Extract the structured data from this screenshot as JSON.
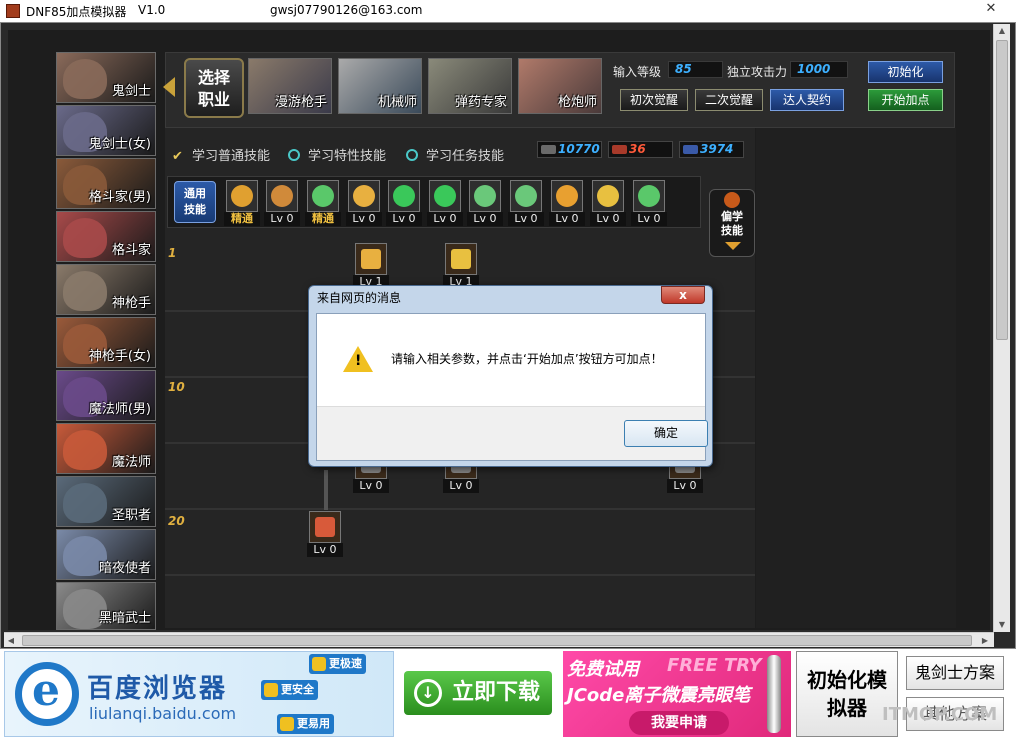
{
  "window": {
    "title": "DNF85加点模拟器",
    "version": "V1.0",
    "email": "gwsj07790126@163.com",
    "close_glyph": "✕"
  },
  "classes": [
    {
      "label": "鬼剑士",
      "color": "#8a6a5a"
    },
    {
      "label": "鬼剑士(女)",
      "color": "#6a6a8a"
    },
    {
      "label": "格斗家(男)",
      "color": "#8a5a3a"
    },
    {
      "label": "格斗家",
      "color": "#a84a4a"
    },
    {
      "label": "神枪手",
      "color": "#8a7a6a"
    },
    {
      "label": "神枪手(女)",
      "color": "#9a5a3a"
    },
    {
      "label": "魔法师(男)",
      "color": "#6a4a8a"
    },
    {
      "label": "魔法师",
      "color": "#c85a3a"
    },
    {
      "label": "圣职者",
      "color": "#5a6a7a"
    },
    {
      "label": "暗夜使者",
      "color": "#7a8aa8"
    },
    {
      "label": "黑暗武士",
      "color": "#8a8a8a"
    }
  ],
  "select_class": {
    "line1": "选择",
    "line2": "职业"
  },
  "subclasses": [
    {
      "label": "漫游枪手"
    },
    {
      "label": "机械师"
    },
    {
      "label": "弹药专家"
    },
    {
      "label": "枪炮师"
    }
  ],
  "inputs": {
    "level_label": "输入等级",
    "level_value": "85",
    "attack_label": "独立攻击力",
    "attack_value": "1000"
  },
  "awaken": {
    "first": "初次觉醒",
    "second": "二次觉醒",
    "contract": "达人契约"
  },
  "actions": {
    "init": "初始化",
    "start": "开始加点"
  },
  "skill_tabs": {
    "normal": "学习普通技能",
    "special": "学习特性技能",
    "quest": "学习任务技能"
  },
  "stats": [
    {
      "value": "10770",
      "color": "#3db0ff",
      "tag_color": "#6a6a6a"
    },
    {
      "value": "36",
      "color": "#ff5a3a",
      "tag_color": "#a83a2a"
    },
    {
      "value": "3974",
      "color": "#3db0ff",
      "tag_color": "#3a5aa8"
    }
  ],
  "common_skill": {
    "line1": "通用",
    "line2": "技能"
  },
  "common_skills": [
    {
      "level": "精通",
      "gold": true,
      "color": "#e0a030"
    },
    {
      "level": "Lv 0",
      "gold": false,
      "color": "#d08a3a"
    },
    {
      "level": "精通",
      "gold": true,
      "color": "#5ac86a"
    },
    {
      "level": "Lv 0",
      "gold": false,
      "color": "#e8b040"
    },
    {
      "level": "Lv 0",
      "gold": false,
      "color": "#3ac85a"
    },
    {
      "level": "Lv 0",
      "gold": false,
      "color": "#3ac85a"
    },
    {
      "level": "Lv 0",
      "gold": false,
      "color": "#6ac87a"
    },
    {
      "level": "Lv 0",
      "gold": false,
      "color": "#6ac87a"
    },
    {
      "level": "Lv 0",
      "gold": false,
      "color": "#e8a030"
    },
    {
      "level": "Lv 0",
      "gold": false,
      "color": "#e8c040"
    },
    {
      "level": "Lv 0",
      "gold": false,
      "color": "#5ac86a"
    }
  ],
  "skill_learn": {
    "line1": "偏学",
    "line2": "技能"
  },
  "level_rows": [
    {
      "level": "1"
    },
    {
      "level": "10"
    },
    {
      "level": "20"
    }
  ],
  "tree_skills": [
    {
      "level": "Lv 1",
      "color": "#e8b040"
    },
    {
      "level": "Lv 1",
      "color": "#e8c040"
    },
    {
      "level": "Lv 0",
      "color": "#888"
    },
    {
      "level": "Lv 0",
      "color": "#888"
    },
    {
      "level": "Lv 0",
      "color": "#888"
    },
    {
      "level": "Lv 0",
      "color": "#d85a3a"
    }
  ],
  "dialog": {
    "title": "来自网页的消息",
    "message": "请输入相关参数，并点击‘开始加点’按钮方可加点！",
    "ok": "确定",
    "close": "x",
    "warn_glyph": "!"
  },
  "ads": {
    "baidu_title": "百度浏览器",
    "baidu_url": "liulanqi.baidu.com",
    "ie_glyph": "e",
    "badge_fast": "更极速",
    "badge_safe": "更安全",
    "badge_easy": "更易用",
    "download": "立即下载",
    "download_glyph": "↓",
    "promo_line1": "免费试用",
    "promo_line1b": "FREE TRY",
    "promo_line2": "JCode离子微震亮眼笔",
    "promo_apply": "我要申请"
  },
  "side_buttons": {
    "init_line1": "初始化模",
    "init_line2": "拟器",
    "plan1": "鬼剑士方案",
    "plan2": "其他方案"
  },
  "watermark": "ITMOP.COM"
}
